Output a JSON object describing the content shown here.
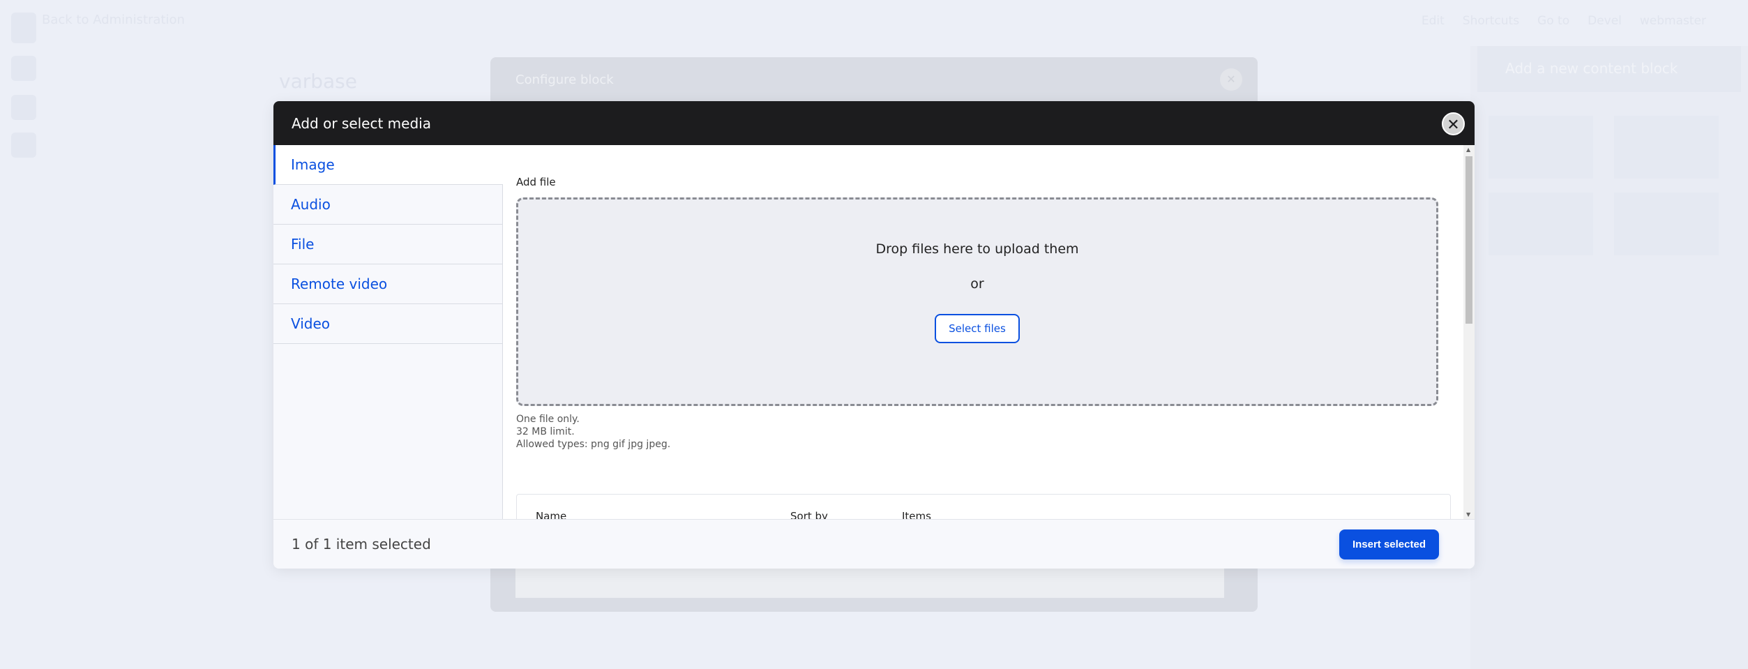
{
  "background": {
    "back_link": "Back to Administration",
    "toolbar": [
      "Edit",
      "Shortcuts",
      "Go to",
      "Devel",
      "webmaster"
    ],
    "brand": "varbase",
    "configure_block_title": "Configure block",
    "side_panel_title": "Add a new content block"
  },
  "modal": {
    "title": "Add or select media",
    "close_icon": "close-icon",
    "tabs": [
      {
        "label": "Image",
        "active": true
      },
      {
        "label": "Audio"
      },
      {
        "label": "File"
      },
      {
        "label": "Remote video"
      },
      {
        "label": "Video"
      }
    ],
    "add_file_label": "Add file",
    "dropzone": {
      "message": "Drop files here to upload them",
      "or": "or",
      "select_button": "Select files"
    },
    "description": [
      "One file only.",
      "32 MB limit.",
      "Allowed types: png gif jpg jpeg."
    ],
    "table_headers": [
      "Name",
      "Sort by",
      "Items"
    ],
    "footer": {
      "selection_count": "1 of 1 item selected",
      "insert_button": "Insert selected"
    }
  },
  "colors": {
    "accent": "#0a50e0",
    "header_bg": "#1c1c1e"
  }
}
